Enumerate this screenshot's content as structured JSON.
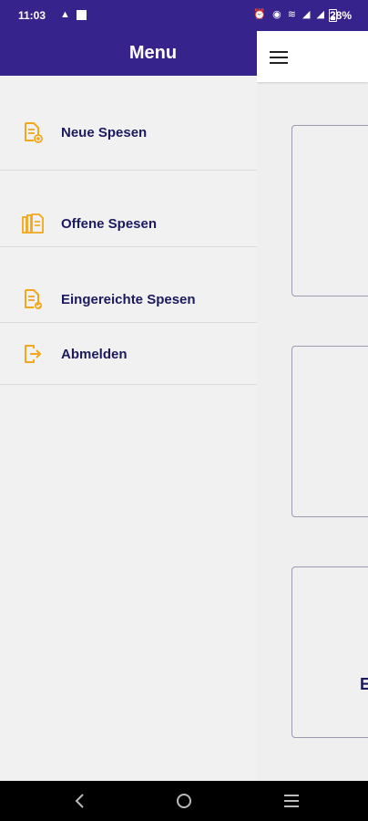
{
  "status_bar": {
    "time": "11:03",
    "notification_glyph": "▲",
    "system_icons": "⏰ ◉ ≋ ◢ ◢",
    "battery_percent": "28%"
  },
  "drawer": {
    "title": "Menu",
    "items": [
      {
        "label": "Neue Spesen",
        "icon": "document-add-icon"
      },
      {
        "label": "Offene Spesen",
        "icon": "documents-stack-icon"
      },
      {
        "label": "Eingereichte Spesen",
        "icon": "document-check-icon"
      },
      {
        "label": "Abmelden",
        "icon": "logout-icon"
      }
    ]
  },
  "background_content": {
    "card_3_text": "E"
  },
  "colors": {
    "brand": "#36248c",
    "accent_icon": "#f3a71b",
    "text": "#1c1a5e"
  }
}
